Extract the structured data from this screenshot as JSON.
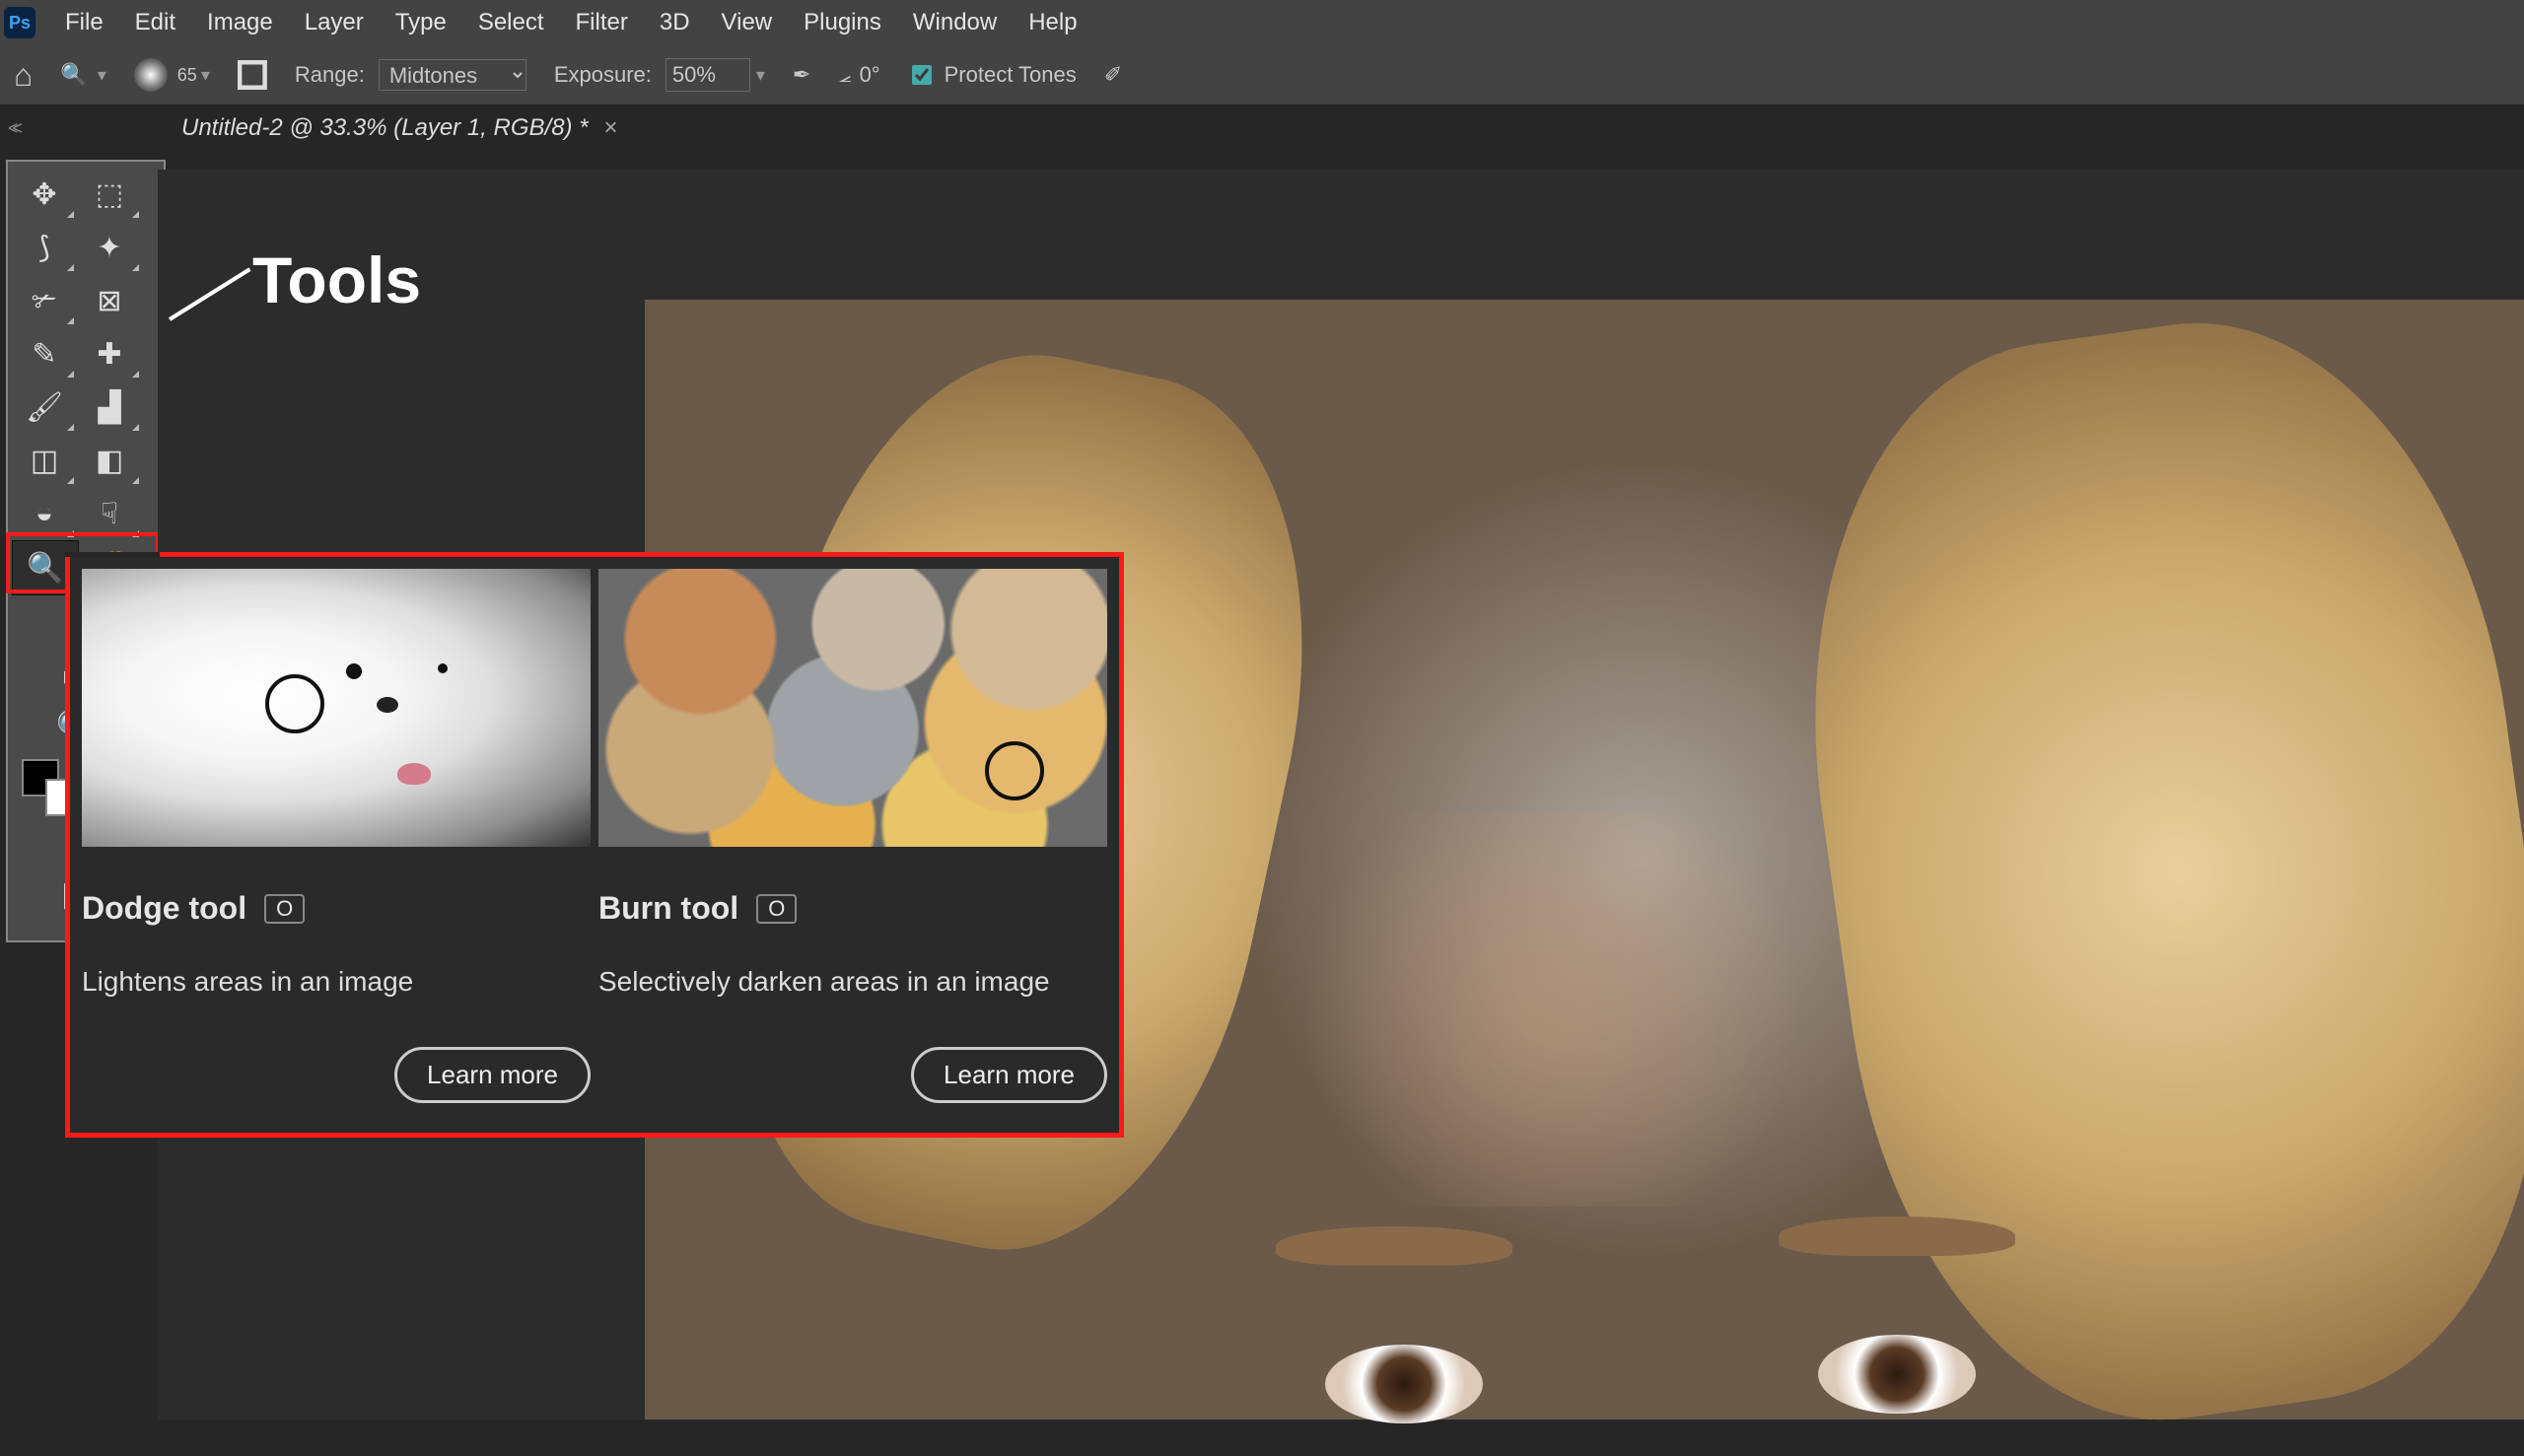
{
  "menu": {
    "file": "File",
    "edit": "Edit",
    "image": "Image",
    "layer": "Layer",
    "type": "Type",
    "select": "Select",
    "filter": "Filter",
    "threeD": "3D",
    "view": "View",
    "plugins": "Plugins",
    "window": "Window",
    "help": "Help"
  },
  "options": {
    "brushSize": "65",
    "rangeLabel": "Range:",
    "rangeValue": "Midtones",
    "exposureLabel": "Exposure:",
    "exposureValue": "50%",
    "angleValue": "0°",
    "protectTones": "Protect Tones"
  },
  "docTab": {
    "title": "Untitled-2 @ 33.3% (Layer 1, RGB/8) *",
    "close": "×"
  },
  "annotation": {
    "label": "Tools"
  },
  "popup": {
    "left": {
      "title": "Dodge tool",
      "kbd": "O",
      "desc": "Lightens areas in an image",
      "btn": "Learn more"
    },
    "right": {
      "title": "Burn tool",
      "kbd": "O",
      "desc": "Selectively darken areas in an image",
      "btn": "Learn more"
    }
  }
}
